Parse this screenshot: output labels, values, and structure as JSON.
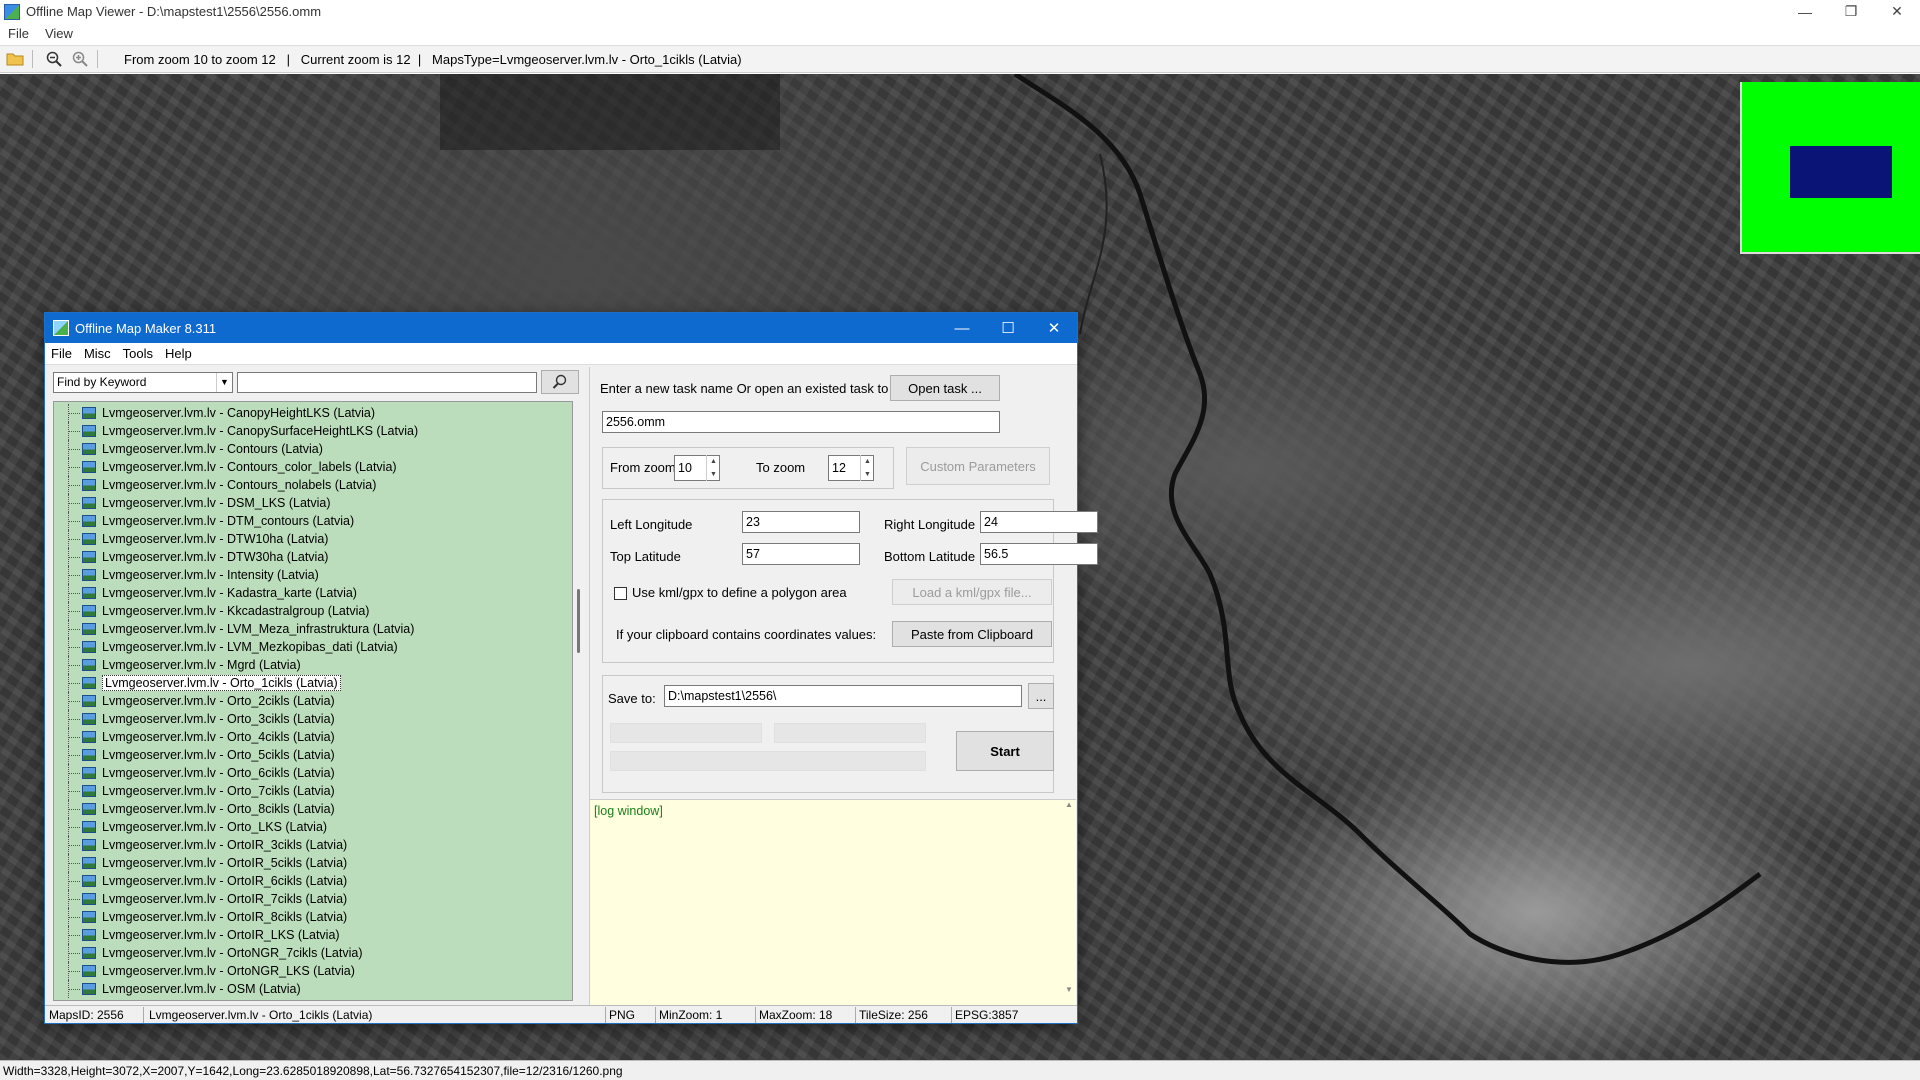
{
  "viewer": {
    "title": "Offline Map Viewer - D:\\mapstest1\\2556\\2556.omm",
    "menu": [
      "File",
      "View"
    ],
    "toolbar_info": "From zoom 10 to zoom 12   |   Current zoom is 12  |   MapsType=Lvmgeoserver.lvm.lv - Orto_1cikls (Latvia)",
    "status_text": "Width=3328,Height=3072,X=2007,Y=1642,Long=23.6285018920898,Lat=56.7327654152307,file=12/2316/1260.png",
    "minimap_colors": {
      "background": "#00ff00",
      "viewport": "#0a1476"
    }
  },
  "dialog": {
    "title": "Offline Map Maker 8.311",
    "menu": [
      "File",
      "Misc",
      "Tools",
      "Help"
    ],
    "search": {
      "combo_value": "Find by Keyword",
      "input_value": ""
    },
    "tree_items": [
      "Lvmgeoserver.lvm.lv - CanopyHeightLKS (Latvia)",
      "Lvmgeoserver.lvm.lv - CanopySurfaceHeightLKS (Latvia)",
      "Lvmgeoserver.lvm.lv - Contours (Latvia)",
      "Lvmgeoserver.lvm.lv - Contours_color_labels (Latvia)",
      "Lvmgeoserver.lvm.lv - Contours_nolabels (Latvia)",
      "Lvmgeoserver.lvm.lv - DSM_LKS (Latvia)",
      "Lvmgeoserver.lvm.lv - DTM_contours (Latvia)",
      "Lvmgeoserver.lvm.lv - DTW10ha (Latvia)",
      "Lvmgeoserver.lvm.lv - DTW30ha (Latvia)",
      "Lvmgeoserver.lvm.lv - Intensity (Latvia)",
      "Lvmgeoserver.lvm.lv - Kadastra_karte (Latvia)",
      "Lvmgeoserver.lvm.lv - Kkcadastralgroup (Latvia)",
      "Lvmgeoserver.lvm.lv - LVM_Meza_infrastruktura (Latvia)",
      "Lvmgeoserver.lvm.lv - LVM_Mezkopibas_dati (Latvia)",
      "Lvmgeoserver.lvm.lv - Mgrd (Latvia)",
      "Lvmgeoserver.lvm.lv - Orto_1cikls (Latvia)",
      "Lvmgeoserver.lvm.lv - Orto_2cikls (Latvia)",
      "Lvmgeoserver.lvm.lv - Orto_3cikls (Latvia)",
      "Lvmgeoserver.lvm.lv - Orto_4cikls (Latvia)",
      "Lvmgeoserver.lvm.lv - Orto_5cikls (Latvia)",
      "Lvmgeoserver.lvm.lv - Orto_6cikls (Latvia)",
      "Lvmgeoserver.lvm.lv - Orto_7cikls (Latvia)",
      "Lvmgeoserver.lvm.lv - Orto_8cikls (Latvia)",
      "Lvmgeoserver.lvm.lv - Orto_LKS (Latvia)",
      "Lvmgeoserver.lvm.lv - OrtoIR_3cikls (Latvia)",
      "Lvmgeoserver.lvm.lv - OrtoIR_5cikls (Latvia)",
      "Lvmgeoserver.lvm.lv - OrtoIR_6cikls (Latvia)",
      "Lvmgeoserver.lvm.lv - OrtoIR_7cikls (Latvia)",
      "Lvmgeoserver.lvm.lv - OrtoIR_8cikls (Latvia)",
      "Lvmgeoserver.lvm.lv - OrtoIR_LKS (Latvia)",
      "Lvmgeoserver.lvm.lv - OrtoNGR_7cikls (Latvia)",
      "Lvmgeoserver.lvm.lv - OrtoNGR_LKS (Latvia)",
      "Lvmgeoserver.lvm.lv - OSM (Latvia)"
    ],
    "selected_item": "Lvmgeoserver.lvm.lv - Orto_1cikls (Latvia)",
    "task_prompt": "Enter a new task name Or open an existed task to continue:",
    "open_task_label": "Open task ...",
    "task_name": "2556.omm",
    "from_zoom_label": "From zoom",
    "from_zoom": "10",
    "to_zoom_label": "To zoom",
    "to_zoom": "12",
    "custom_params_label": "Custom Parameters",
    "left_lon_label": "Left Longitude",
    "left_lon": "23",
    "right_lon_label": "Right Longitude",
    "right_lon": "24",
    "top_lat_label": "Top Latitude",
    "top_lat": "57",
    "bottom_lat_label": "Bottom Latitude",
    "bottom_lat": "56.5",
    "kml_label": "Use kml/gpx to define a polygon area",
    "load_kml_label": "Load a kml/gpx file...",
    "clipboard_prompt": "If your clipboard contains coordinates values:",
    "paste_label": "Paste from Clipboard",
    "save_to_label": "Save to:",
    "save_to": "D:\\mapstest1\\2556\\",
    "browse_label": "...",
    "start_label": "Start",
    "log_text": "[log window]",
    "status": {
      "maps_id": "MapsID: 2556",
      "map_name": "Lvmgeoserver.lvm.lv - Orto_1cikls (Latvia)",
      "format": "PNG",
      "min_zoom": "MinZoom: 1",
      "max_zoom": "MaxZoom: 18",
      "tile_size": "TileSize: 256",
      "epsg": "EPSG:3857"
    }
  }
}
